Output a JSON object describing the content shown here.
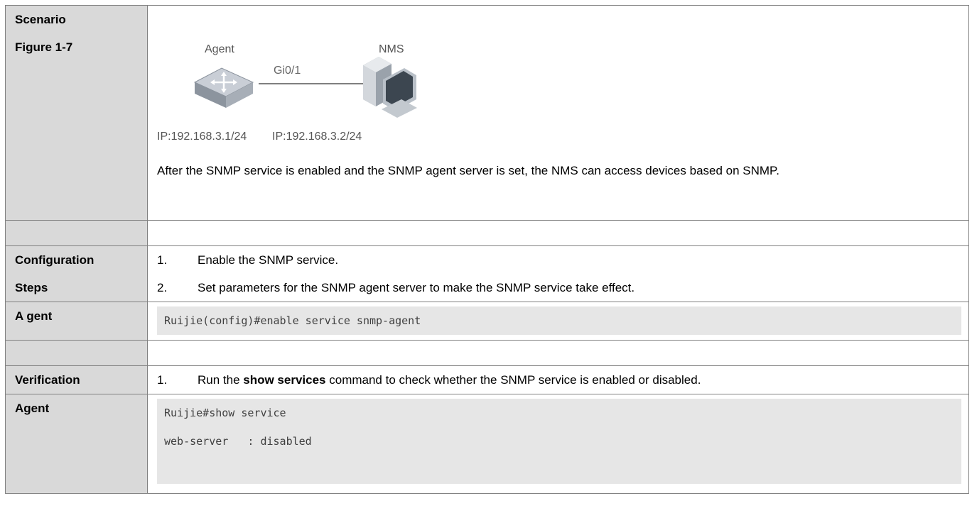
{
  "rows": {
    "scenario": {
      "label_1": "Scenario",
      "label_2": "Figure 1-7",
      "figure": {
        "agent_label": "Agent",
        "nms_label": "NMS",
        "link_label": "Gi0/1",
        "agent_ip": "IP:192.168.3.1/24",
        "nms_ip": "IP:192.168.3.2/24",
        "agent_icon": "router-switch-icon",
        "nms_icon": "computer-workstation-icon"
      },
      "description": "After the SNMP service is enabled and the SNMP agent server is set, the NMS can access devices based on SNMP."
    },
    "config": {
      "label_1": "Configuration",
      "label_2": "Steps",
      "steps": [
        {
          "num": "1.",
          "text": "Enable the SNMP service."
        },
        {
          "num": "2.",
          "text": "Set parameters for the SNMP agent server to make the SNMP service take effect."
        }
      ]
    },
    "agent_config": {
      "label": "A gent",
      "code": "Ruijie(config)#enable service snmp-agent"
    },
    "verification": {
      "label": "Verification",
      "num": "1.",
      "text_before": "Run the ",
      "text_bold": "show services",
      "text_after": " command to check whether the SNMP service is enabled or disabled."
    },
    "agent_verify": {
      "label": "Agent",
      "code_lines": [
        "Ruijie#show service",
        "web-server   : disabled"
      ]
    }
  }
}
